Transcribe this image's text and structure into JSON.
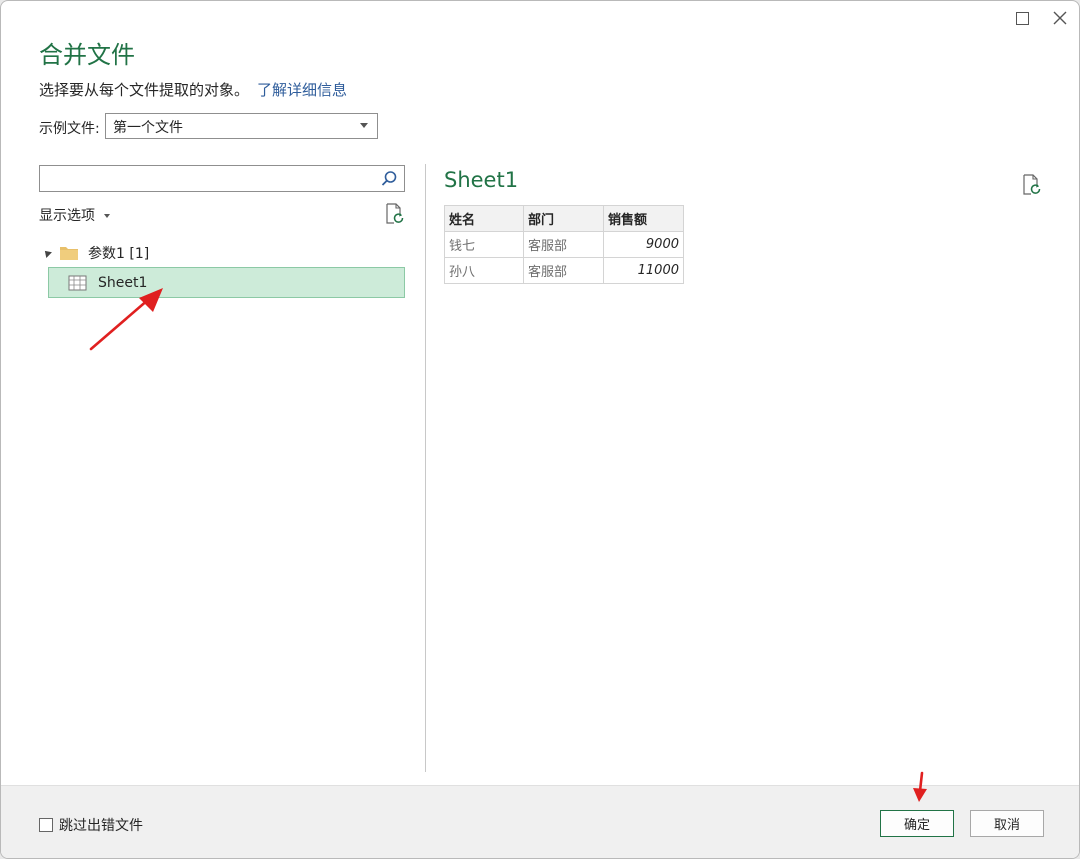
{
  "dialog": {
    "title": "合并文件",
    "subtitle": "选择要从每个文件提取的对象。",
    "learn_more": "了解详细信息"
  },
  "sample_file": {
    "label": "示例文件:",
    "selected": "第一个文件"
  },
  "navigator": {
    "search_placeholder": "",
    "display_options": "显示选项",
    "folder_label": "参数1 [1]",
    "selected_item": "Sheet1"
  },
  "preview": {
    "title": "Sheet1",
    "columns": [
      "姓名",
      "部门",
      "销售额"
    ],
    "rows": [
      [
        "钱七",
        "客服部",
        "9000"
      ],
      [
        "孙八",
        "客服部",
        "11000"
      ]
    ]
  },
  "footer": {
    "skip_label": "跳过出错文件",
    "ok_label": "确定",
    "cancel_label": "取消"
  },
  "colors": {
    "accent": "#217346",
    "link": "#2f5d9b",
    "selection": "#cdebd9",
    "annotation": "#e02020"
  },
  "icons": [
    "maximize-icon",
    "close-icon",
    "search-icon",
    "refresh-icon",
    "folder-icon",
    "sheet-table-icon",
    "dropdown-caret-icon",
    "expand-triangle-icon"
  ]
}
